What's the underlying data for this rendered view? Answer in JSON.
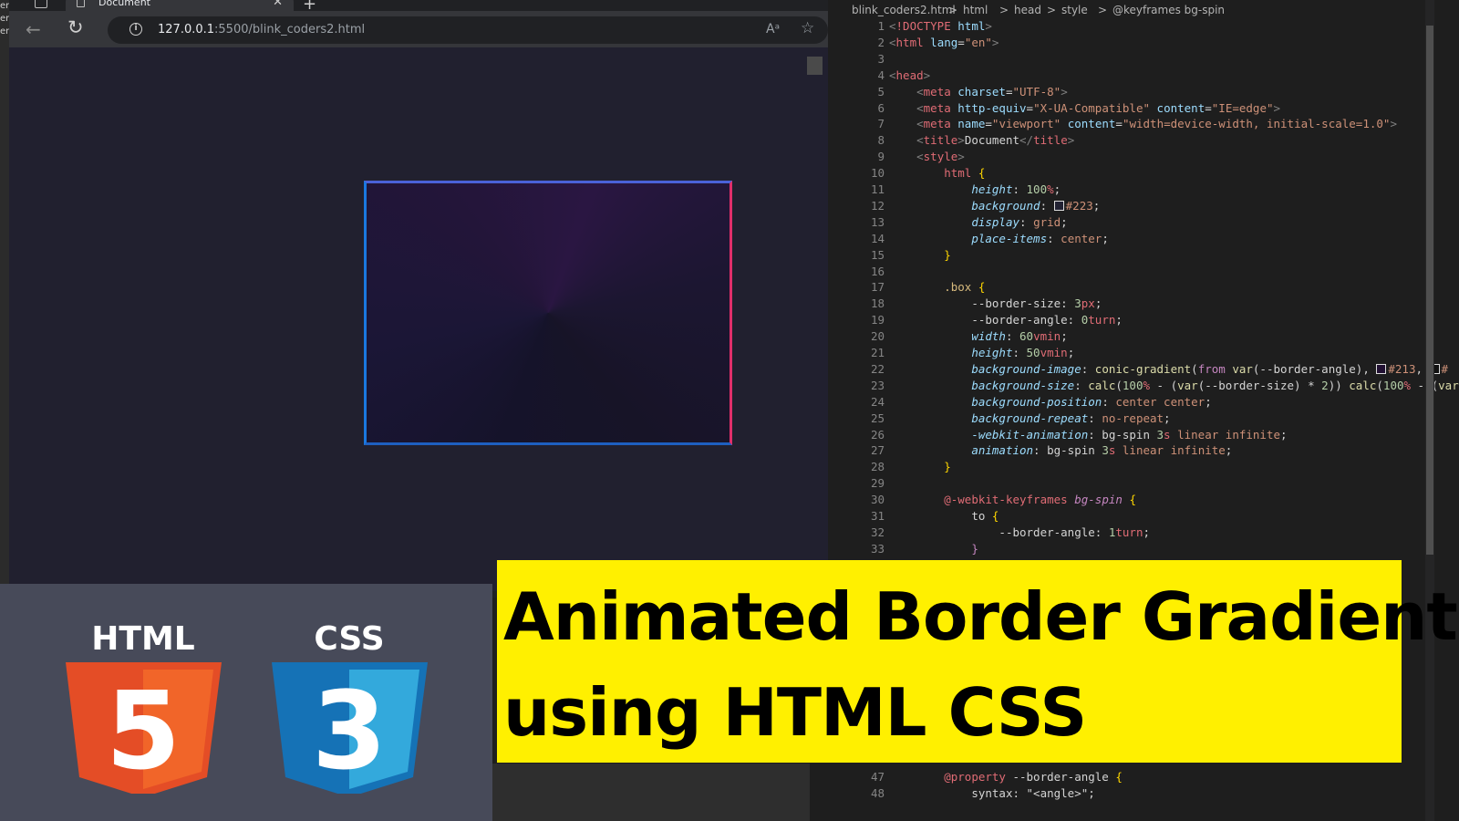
{
  "browser": {
    "left_edge_fragments": [
      "er",
      "er",
      "er"
    ],
    "tab_title": "Document",
    "tab_close": "✕",
    "new_tab": "+",
    "url_host": "127.0.0.1",
    "url_rest": ":5500/blink_coders2.html",
    "read_aloud": "Aᵃ",
    "favorite": "☆"
  },
  "editor": {
    "breadcrumb": [
      "blink_coders2.html",
      ">",
      "html",
      ">",
      "head",
      ">",
      "style",
      ">",
      "@keyframes bg-spin"
    ],
    "lines": [
      {
        "n": "1",
        "segs": [
          [
            "angle",
            "<"
          ],
          [
            "name",
            "!DOCTYPE"
          ],
          [
            "plain",
            " "
          ],
          [
            "attr",
            "html"
          ],
          [
            "angle",
            ">"
          ]
        ]
      },
      {
        "n": "2",
        "segs": [
          [
            "angle",
            "<"
          ],
          [
            "name",
            "html"
          ],
          [
            "plain",
            " "
          ],
          [
            "attr",
            "lang"
          ],
          [
            "plain",
            "="
          ],
          [
            "str",
            "\"en\""
          ],
          [
            "angle",
            ">"
          ]
        ]
      },
      {
        "n": "3",
        "segs": []
      },
      {
        "n": "4",
        "segs": [
          [
            "angle",
            "<"
          ],
          [
            "name",
            "head"
          ],
          [
            "angle",
            ">"
          ]
        ]
      },
      {
        "n": "5",
        "segs": [
          [
            "plain",
            "    "
          ],
          [
            "angle",
            "<"
          ],
          [
            "name",
            "meta"
          ],
          [
            "plain",
            " "
          ],
          [
            "attr",
            "charset"
          ],
          [
            "plain",
            "="
          ],
          [
            "str",
            "\"UTF-8\""
          ],
          [
            "angle",
            ">"
          ]
        ]
      },
      {
        "n": "6",
        "segs": [
          [
            "plain",
            "    "
          ],
          [
            "angle",
            "<"
          ],
          [
            "name",
            "meta"
          ],
          [
            "plain",
            " "
          ],
          [
            "attr",
            "http-equiv"
          ],
          [
            "plain",
            "="
          ],
          [
            "str",
            "\"X-UA-Compatible\""
          ],
          [
            "plain",
            " "
          ],
          [
            "attr",
            "content"
          ],
          [
            "plain",
            "="
          ],
          [
            "str",
            "\"IE=edge\""
          ],
          [
            "angle",
            ">"
          ]
        ]
      },
      {
        "n": "7",
        "segs": [
          [
            "plain",
            "    "
          ],
          [
            "angle",
            "<"
          ],
          [
            "name",
            "meta"
          ],
          [
            "plain",
            " "
          ],
          [
            "attr",
            "name"
          ],
          [
            "plain",
            "="
          ],
          [
            "str",
            "\"viewport\""
          ],
          [
            "plain",
            " "
          ],
          [
            "attr",
            "content"
          ],
          [
            "plain",
            "="
          ],
          [
            "str",
            "\"width=device-width, initial-scale=1.0\""
          ],
          [
            "angle",
            ">"
          ]
        ]
      },
      {
        "n": "8",
        "segs": [
          [
            "plain",
            "    "
          ],
          [
            "angle",
            "<"
          ],
          [
            "name",
            "title"
          ],
          [
            "angle",
            ">"
          ],
          [
            "plain",
            "Document"
          ],
          [
            "angle",
            "</"
          ],
          [
            "name",
            "title"
          ],
          [
            "angle",
            ">"
          ]
        ]
      },
      {
        "n": "9",
        "segs": [
          [
            "plain",
            "    "
          ],
          [
            "angle",
            "<"
          ],
          [
            "name",
            "style"
          ],
          [
            "angle",
            ">"
          ]
        ]
      },
      {
        "n": "10",
        "segs": [
          [
            "plain",
            "        "
          ],
          [
            "name",
            "html"
          ],
          [
            "plain",
            " "
          ],
          [
            "brace",
            "{"
          ]
        ]
      },
      {
        "n": "11",
        "segs": [
          [
            "plain",
            "            "
          ],
          [
            "prop",
            "height"
          ],
          [
            "plain",
            ": "
          ],
          [
            "num",
            "100"
          ],
          [
            "unit",
            "%"
          ],
          [
            "plain",
            ";"
          ]
        ]
      },
      {
        "n": "12",
        "segs": [
          [
            "plain",
            "            "
          ],
          [
            "prop",
            "background"
          ],
          [
            "plain",
            ": "
          ],
          [
            "swatch",
            "#222233"
          ],
          [
            "str",
            "#223"
          ],
          [
            "plain",
            ";"
          ]
        ]
      },
      {
        "n": "13",
        "segs": [
          [
            "plain",
            "            "
          ],
          [
            "prop",
            "display"
          ],
          [
            "plain",
            ": "
          ],
          [
            "str",
            "grid"
          ],
          [
            "plain",
            ";"
          ]
        ]
      },
      {
        "n": "14",
        "segs": [
          [
            "plain",
            "            "
          ],
          [
            "prop",
            "place-items"
          ],
          [
            "plain",
            ": "
          ],
          [
            "str",
            "center"
          ],
          [
            "plain",
            ";"
          ]
        ]
      },
      {
        "n": "15",
        "segs": [
          [
            "plain",
            "        "
          ],
          [
            "brace",
            "}"
          ]
        ]
      },
      {
        "n": "16",
        "segs": []
      },
      {
        "n": "17",
        "segs": [
          [
            "plain",
            "        "
          ],
          [
            "sel",
            ".box"
          ],
          [
            "plain",
            " "
          ],
          [
            "brace",
            "{"
          ]
        ]
      },
      {
        "n": "18",
        "segs": [
          [
            "plain",
            "            "
          ],
          [
            "plain",
            "--border-size"
          ],
          [
            "plain",
            ": "
          ],
          [
            "num",
            "3"
          ],
          [
            "unit",
            "px"
          ],
          [
            "plain",
            ";"
          ]
        ]
      },
      {
        "n": "19",
        "segs": [
          [
            "plain",
            "            "
          ],
          [
            "plain",
            "--border-angle"
          ],
          [
            "plain",
            ": "
          ],
          [
            "num",
            "0"
          ],
          [
            "unit",
            "turn"
          ],
          [
            "plain",
            ";"
          ]
        ]
      },
      {
        "n": "20",
        "segs": [
          [
            "plain",
            "            "
          ],
          [
            "prop",
            "width"
          ],
          [
            "plain",
            ": "
          ],
          [
            "num",
            "60"
          ],
          [
            "unit",
            "vmin"
          ],
          [
            "plain",
            ";"
          ]
        ]
      },
      {
        "n": "21",
        "segs": [
          [
            "plain",
            "            "
          ],
          [
            "prop",
            "height"
          ],
          [
            "plain",
            ": "
          ],
          [
            "num",
            "50"
          ],
          [
            "unit",
            "vmin"
          ],
          [
            "plain",
            ";"
          ]
        ]
      },
      {
        "n": "22",
        "segs": [
          [
            "plain",
            "            "
          ],
          [
            "prop",
            "background-image"
          ],
          [
            "plain",
            ": "
          ],
          [
            "fn",
            "conic-gradient"
          ],
          [
            "plain",
            "("
          ],
          [
            "kw",
            "from"
          ],
          [
            "plain",
            " "
          ],
          [
            "fn",
            "var"
          ],
          [
            "plain",
            "(--border-angle), "
          ],
          [
            "swatch",
            "#221133"
          ],
          [
            "str",
            "#213"
          ],
          [
            "plain",
            ", "
          ],
          [
            "swatch",
            "#111111"
          ],
          [
            "str",
            "#"
          ]
        ]
      },
      {
        "n": "23",
        "segs": [
          [
            "plain",
            "            "
          ],
          [
            "prop",
            "background-size"
          ],
          [
            "plain",
            ": "
          ],
          [
            "fn",
            "calc"
          ],
          [
            "plain",
            "("
          ],
          [
            "num",
            "100"
          ],
          [
            "unit",
            "%"
          ],
          [
            "plain",
            " - ("
          ],
          [
            "fn",
            "var"
          ],
          [
            "plain",
            "(--border-size) * "
          ],
          [
            "num",
            "2"
          ],
          [
            "plain",
            ")) "
          ],
          [
            "fn",
            "calc"
          ],
          [
            "plain",
            "("
          ],
          [
            "num",
            "100"
          ],
          [
            "unit",
            "%"
          ],
          [
            "plain",
            " - ("
          ],
          [
            "fn",
            "var"
          ]
        ]
      },
      {
        "n": "24",
        "segs": [
          [
            "plain",
            "            "
          ],
          [
            "prop",
            "background-position"
          ],
          [
            "plain",
            ": "
          ],
          [
            "str",
            "center center"
          ],
          [
            "plain",
            ";"
          ]
        ]
      },
      {
        "n": "25",
        "segs": [
          [
            "plain",
            "            "
          ],
          [
            "prop",
            "background-repeat"
          ],
          [
            "plain",
            ": "
          ],
          [
            "str",
            "no-repeat"
          ],
          [
            "plain",
            ";"
          ]
        ]
      },
      {
        "n": "26",
        "segs": [
          [
            "plain",
            "            "
          ],
          [
            "prop",
            "-webkit-animation"
          ],
          [
            "plain",
            ": bg-spin "
          ],
          [
            "num",
            "3"
          ],
          [
            "unit",
            "s"
          ],
          [
            "plain",
            " "
          ],
          [
            "str",
            "linear infinite"
          ],
          [
            "plain",
            ";"
          ]
        ]
      },
      {
        "n": "27",
        "segs": [
          [
            "plain",
            "            "
          ],
          [
            "prop",
            "animation"
          ],
          [
            "plain",
            ": bg-spin "
          ],
          [
            "num",
            "3"
          ],
          [
            "unit",
            "s"
          ],
          [
            "plain",
            " "
          ],
          [
            "str",
            "linear infinite"
          ],
          [
            "plain",
            ";"
          ]
        ]
      },
      {
        "n": "28",
        "segs": [
          [
            "plain",
            "        "
          ],
          [
            "brace",
            "}"
          ]
        ]
      },
      {
        "n": "29",
        "segs": []
      },
      {
        "n": "30",
        "segs": [
          [
            "plain",
            "        "
          ],
          [
            "name",
            "@-webkit-keyframes"
          ],
          [
            "plain",
            " "
          ],
          [
            "at",
            "bg-spin"
          ],
          [
            "plain",
            " "
          ],
          [
            "brace",
            "{"
          ]
        ]
      },
      {
        "n": "31",
        "segs": [
          [
            "plain",
            "            "
          ],
          [
            "plain",
            "to "
          ],
          [
            "brace",
            "{"
          ]
        ]
      },
      {
        "n": "32",
        "segs": [
          [
            "plain",
            "                "
          ],
          [
            "plain",
            "--border-angle"
          ],
          [
            "plain",
            ": "
          ],
          [
            "num",
            "1"
          ],
          [
            "unit",
            "turn"
          ],
          [
            "plain",
            ";"
          ]
        ]
      },
      {
        "n": "33",
        "segs": [
          [
            "plain",
            "            "
          ],
          [
            "kw",
            "}"
          ]
        ]
      }
    ],
    "bottom_lines": [
      {
        "n": "47",
        "segs": [
          [
            "plain",
            "        "
          ],
          [
            "name",
            "@property"
          ],
          [
            "plain",
            " --border-angle "
          ],
          [
            "brace",
            "{"
          ]
        ]
      },
      {
        "n": "48",
        "segs": [
          [
            "plain",
            "            "
          ],
          [
            "plain",
            "syntax: \"<angle>\";"
          ]
        ]
      }
    ]
  },
  "logos": {
    "html_label": "HTML",
    "html_digit": "5",
    "css_label": "CSS",
    "css_digit": "3"
  },
  "banner": {
    "line1": "Animated Border Gradient",
    "line2": "using HTML CSS"
  }
}
